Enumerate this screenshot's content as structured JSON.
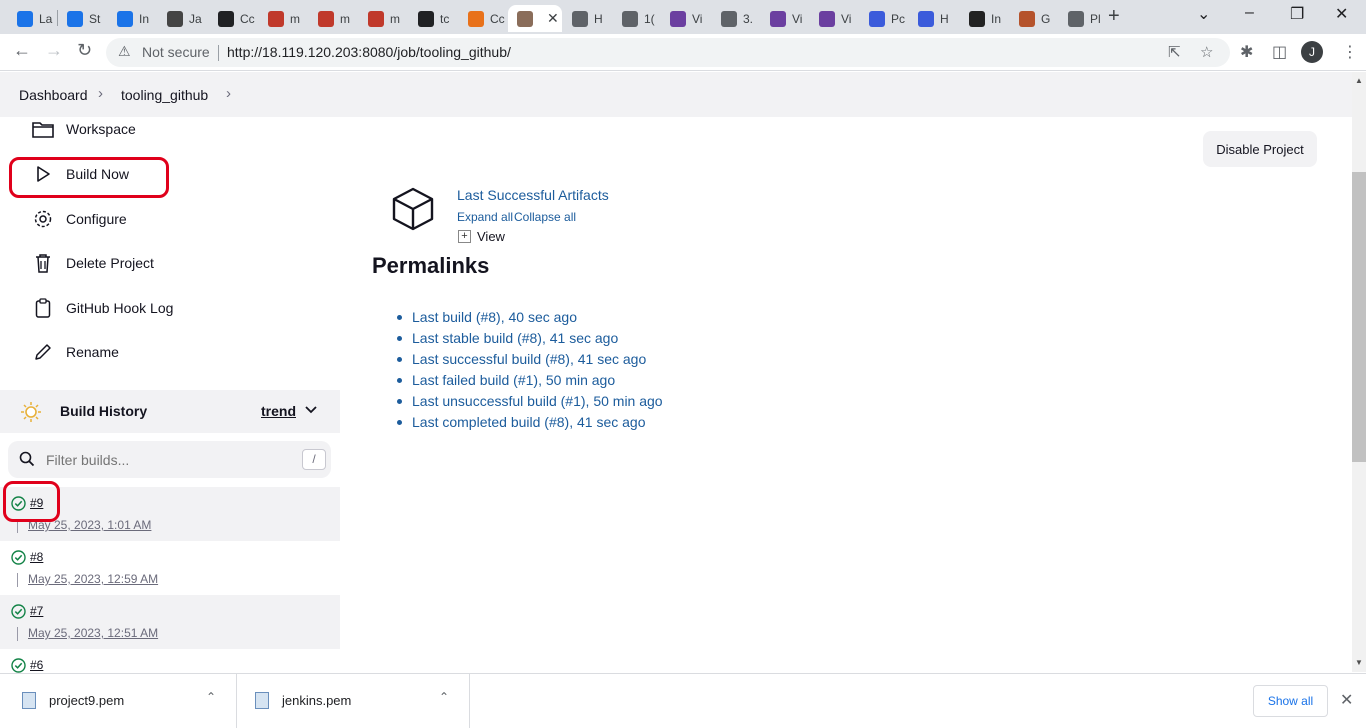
{
  "browser": {
    "tabs": [
      {
        "label": "La",
        "color": "#1a73e8"
      },
      {
        "label": "St",
        "color": "#1a73e8"
      },
      {
        "label": "In",
        "color": "#1a73e8"
      },
      {
        "label": "Ja",
        "color": "#444444"
      },
      {
        "label": "Cc",
        "color": "#202124"
      },
      {
        "label": "m",
        "color": "#c0392b"
      },
      {
        "label": "m",
        "color": "#c0392b"
      },
      {
        "label": "m",
        "color": "#c0392b"
      },
      {
        "label": "tc",
        "color": "#202124"
      },
      {
        "label": "Cc",
        "color": "#e8711a"
      },
      {
        "label": "",
        "color": "#8a6d5a",
        "active": true
      },
      {
        "label": "H",
        "color": "#5f6368"
      },
      {
        "label": "1(",
        "color": "#5f6368"
      },
      {
        "label": "Vi",
        "color": "#6b3fa0"
      },
      {
        "label": "3.",
        "color": "#5f6368"
      },
      {
        "label": "Vi",
        "color": "#6b3fa0"
      },
      {
        "label": "Vi",
        "color": "#6b3fa0"
      },
      {
        "label": "Pc",
        "color": "#3b5bdb"
      },
      {
        "label": "H",
        "color": "#3b5bdb"
      },
      {
        "label": "In",
        "color": "#222222"
      },
      {
        "label": "G",
        "color": "#b5532c"
      },
      {
        "label": "Pl",
        "color": "#5f6368"
      }
    ],
    "not_secure": "Not secure",
    "url": "http://18.119.120.203:8080/job/tooling_github/",
    "avatar_letter": "J"
  },
  "breadcrumb": {
    "items": [
      "Dashboard",
      "tooling_github"
    ]
  },
  "sidebar": {
    "tasks": [
      {
        "label": "Workspace",
        "icon": "folder-icon"
      },
      {
        "label": "Build Now",
        "icon": "play-icon"
      },
      {
        "label": "Configure",
        "icon": "gear-icon"
      },
      {
        "label": "Delete Project",
        "icon": "trash-icon"
      },
      {
        "label": "GitHub Hook Log",
        "icon": "clipboard-icon"
      },
      {
        "label": "Rename",
        "icon": "pencil-icon"
      }
    ]
  },
  "build_history": {
    "title": "Build History",
    "trend": "trend",
    "filter_placeholder": "Filter builds...",
    "filter_shortcut": "/",
    "builds": [
      {
        "number": "#9",
        "date": "May 25, 2023, 1:01 AM"
      },
      {
        "number": "#8",
        "date": "May 25, 2023, 12:59 AM"
      },
      {
        "number": "#7",
        "date": "May 25, 2023, 12:51 AM"
      },
      {
        "number": "#6",
        "date": ""
      }
    ]
  },
  "main": {
    "disable_button": "Disable Project",
    "artifacts": {
      "title": "Last Successful Artifacts",
      "expand": "Expand all",
      "collapse": "Collapse all",
      "view": "View"
    },
    "permalinks_heading": "Permalinks",
    "permalinks": [
      "Last build (#8), 40 sec ago",
      "Last stable build (#8), 41 sec ago",
      "Last successful build (#8), 41 sec ago",
      "Last failed build (#1), 50 min ago",
      "Last unsuccessful build (#1), 50 min ago",
      "Last completed build (#8), 41 sec ago"
    ]
  },
  "downloads": {
    "items": [
      "project9.pem",
      "jenkins.pem"
    ],
    "show_all": "Show all"
  },
  "colors": {
    "link": "#1c5c9c",
    "annotation": "#e0001b",
    "success": "#138347"
  }
}
